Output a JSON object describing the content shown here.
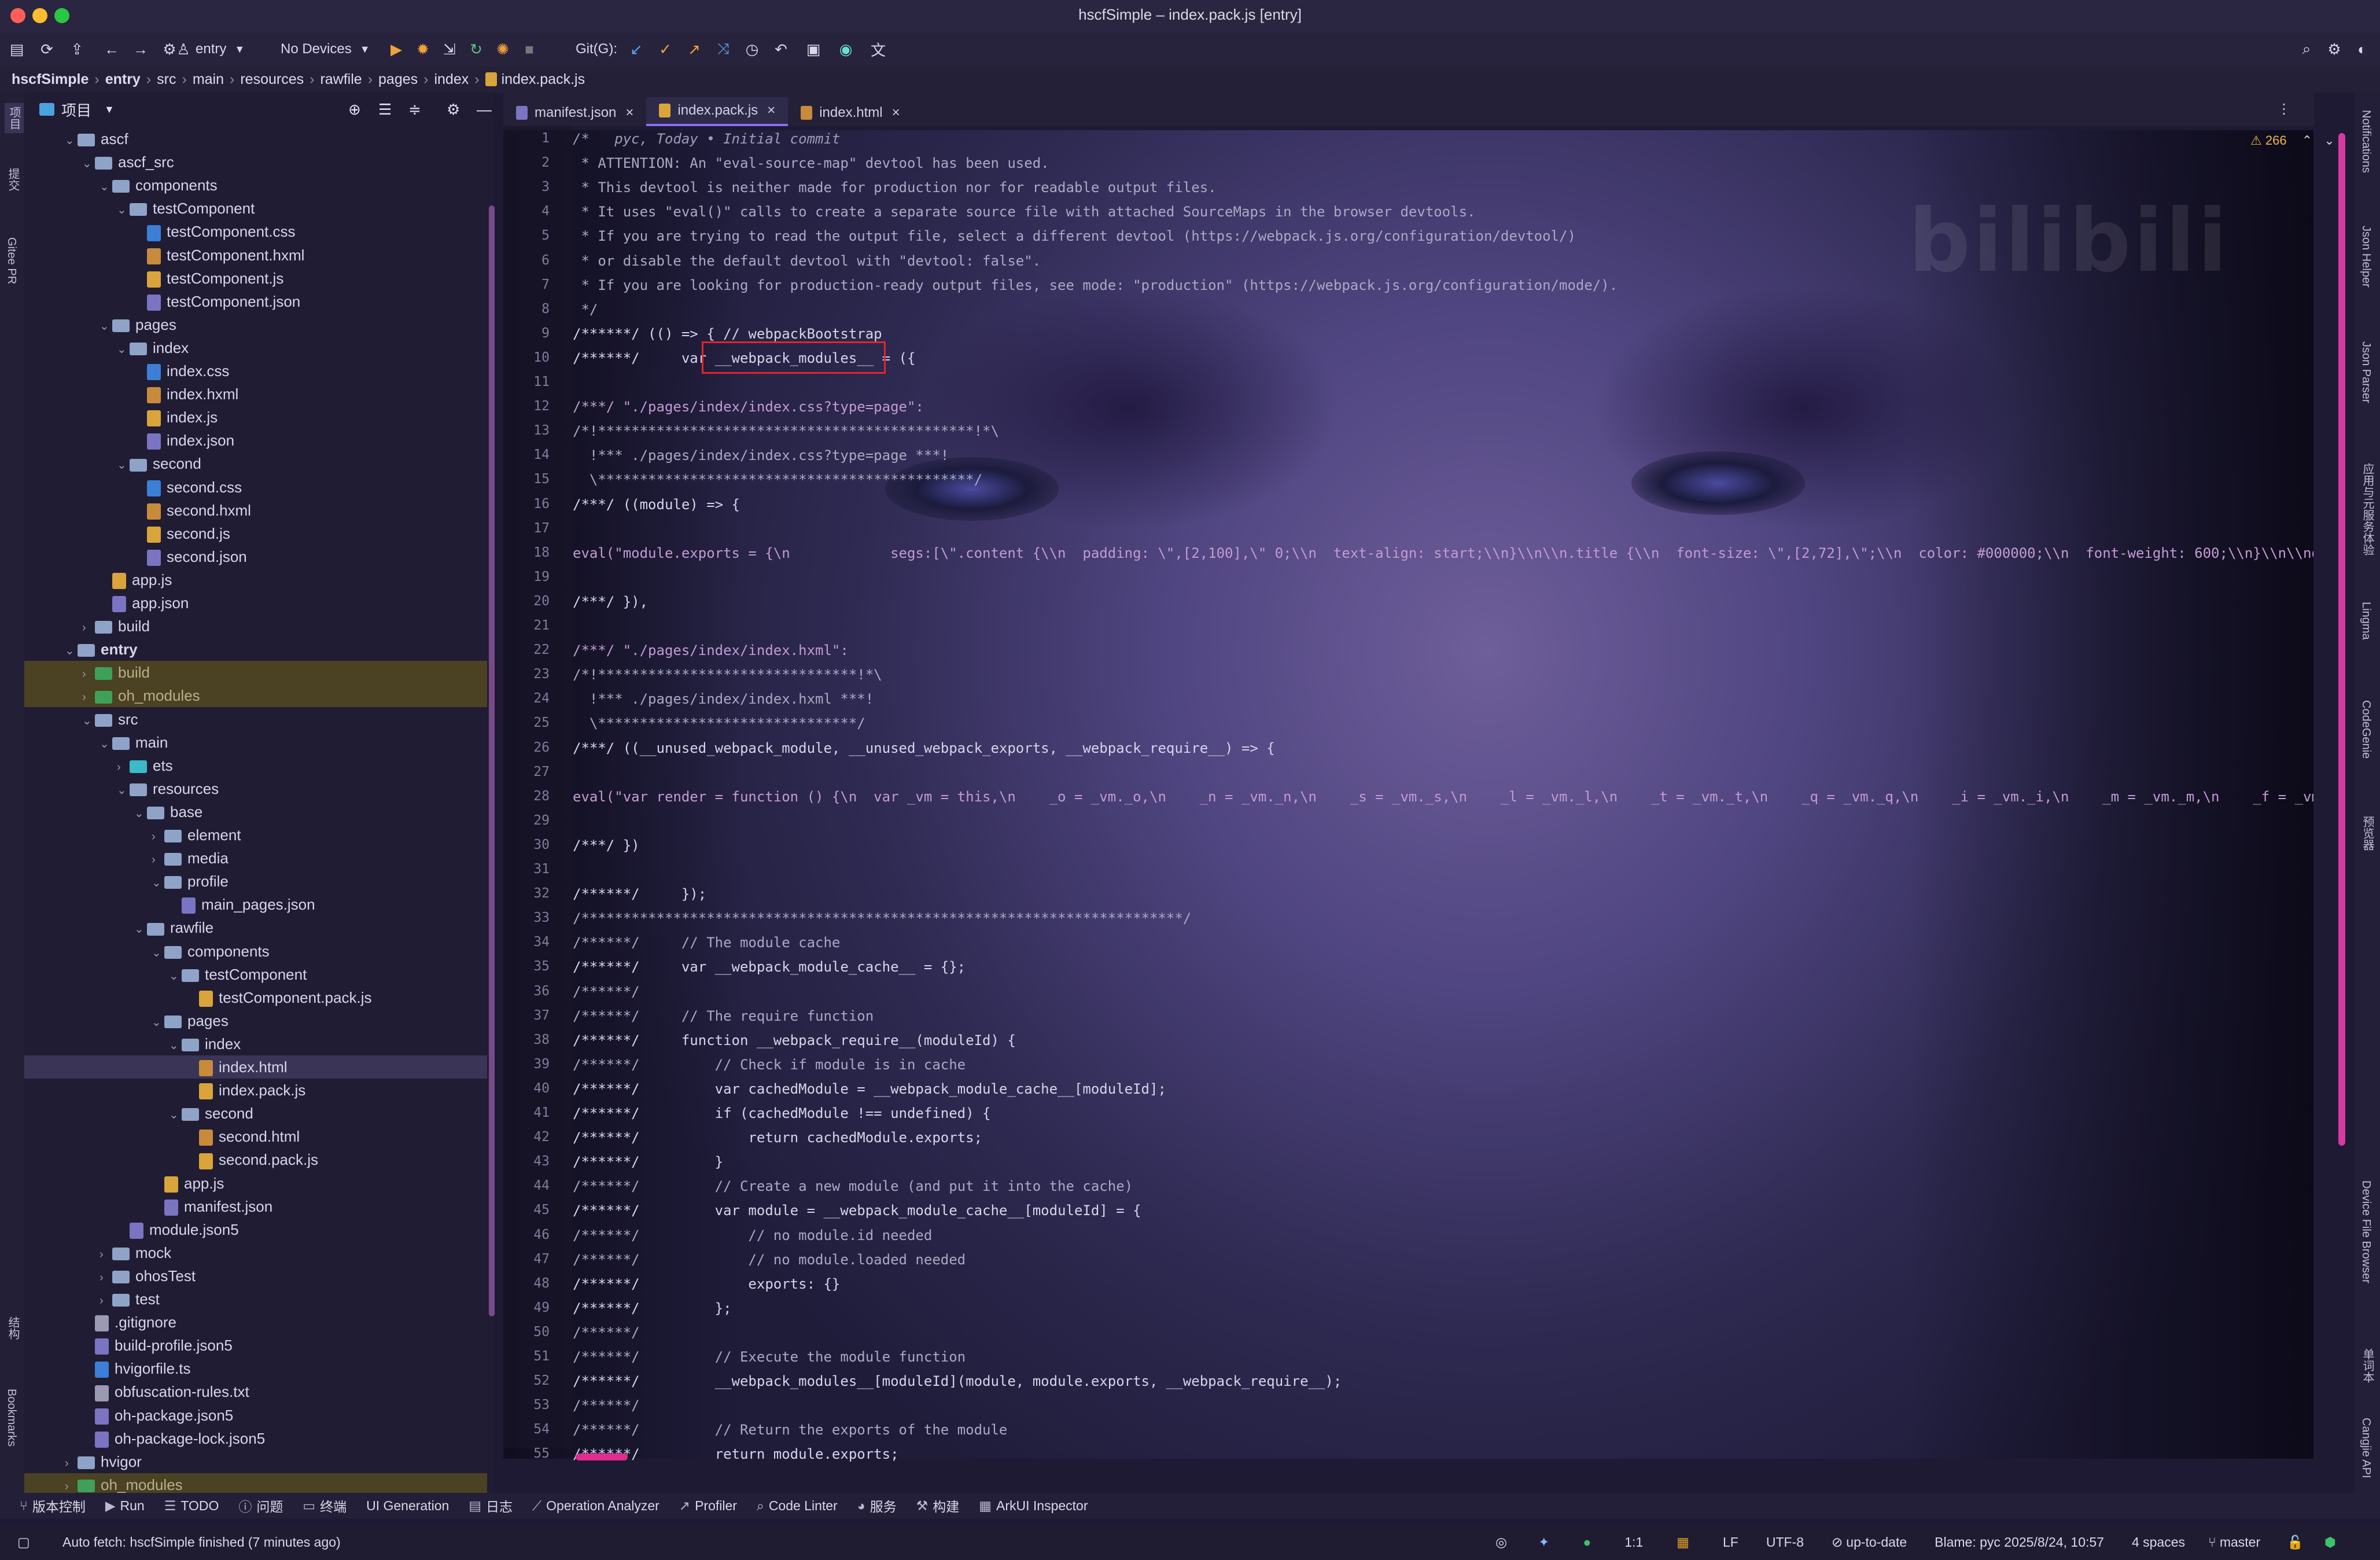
{
  "window": {
    "title": "hscfSimple – index.pack.js [entry]"
  },
  "toolbar": {
    "module": "entry",
    "devices": "No Devices",
    "git_label": "Git(G):"
  },
  "breadcrumb": [
    "hscfSimple",
    "entry",
    "src",
    "main",
    "resources",
    "rawfile",
    "pages",
    "index",
    "index.pack.js"
  ],
  "left_strip": {
    "project": "项目",
    "commit": "提交",
    "gitee": "Gitee PR",
    "structure": "结构",
    "bookmarks": "Bookmarks"
  },
  "project_panel": {
    "title": "项目",
    "tree": [
      {
        "depth": 1,
        "type": "folder",
        "name": "ascf",
        "open": true
      },
      {
        "depth": 2,
        "type": "folder",
        "name": "ascf_src",
        "open": true
      },
      {
        "depth": 3,
        "type": "folder",
        "name": "components",
        "open": true
      },
      {
        "depth": 4,
        "type": "folder",
        "name": "testComponent",
        "open": true
      },
      {
        "depth": 5,
        "type": "css",
        "name": "testComponent.css"
      },
      {
        "depth": 5,
        "type": "hxml",
        "name": "testComponent.hxml"
      },
      {
        "depth": 5,
        "type": "js",
        "name": "testComponent.js"
      },
      {
        "depth": 5,
        "type": "json",
        "name": "testComponent.json"
      },
      {
        "depth": 3,
        "type": "folder",
        "name": "pages",
        "open": true
      },
      {
        "depth": 4,
        "type": "folder",
        "name": "index",
        "open": true
      },
      {
        "depth": 5,
        "type": "css",
        "name": "index.css"
      },
      {
        "depth": 5,
        "type": "hxml",
        "name": "index.hxml"
      },
      {
        "depth": 5,
        "type": "js",
        "name": "index.js"
      },
      {
        "depth": 5,
        "type": "json",
        "name": "index.json"
      },
      {
        "depth": 4,
        "type": "folder",
        "name": "second",
        "open": true
      },
      {
        "depth": 5,
        "type": "css",
        "name": "second.css"
      },
      {
        "depth": 5,
        "type": "hxml",
        "name": "second.hxml"
      },
      {
        "depth": 5,
        "type": "js",
        "name": "second.js"
      },
      {
        "depth": 5,
        "type": "json",
        "name": "second.json"
      },
      {
        "depth": 3,
        "type": "js",
        "name": "app.js"
      },
      {
        "depth": 3,
        "type": "json",
        "name": "app.json"
      },
      {
        "depth": 2,
        "type": "folder",
        "name": "build",
        "open": false
      },
      {
        "depth": 1,
        "type": "folder",
        "name": "entry",
        "open": true,
        "bold": true
      },
      {
        "depth": 2,
        "type": "folder-green",
        "name": "build",
        "open": false,
        "hl": true
      },
      {
        "depth": 2,
        "type": "folder-green",
        "name": "oh_modules",
        "open": false,
        "hl": true
      },
      {
        "depth": 2,
        "type": "folder",
        "name": "src",
        "open": true
      },
      {
        "depth": 3,
        "type": "folder",
        "name": "main",
        "open": true
      },
      {
        "depth": 4,
        "type": "folder-cyan",
        "name": "ets",
        "open": false
      },
      {
        "depth": 4,
        "type": "folder",
        "name": "resources",
        "open": true
      },
      {
        "depth": 5,
        "type": "folder",
        "name": "base",
        "open": true
      },
      {
        "depth": 6,
        "type": "folder",
        "name": "element",
        "open": false
      },
      {
        "depth": 6,
        "type": "folder",
        "name": "media",
        "open": false
      },
      {
        "depth": 6,
        "type": "folder",
        "name": "profile",
        "open": true
      },
      {
        "depth": 7,
        "type": "json",
        "name": "main_pages.json"
      },
      {
        "depth": 5,
        "type": "folder",
        "name": "rawfile",
        "open": true
      },
      {
        "depth": 6,
        "type": "folder",
        "name": "components",
        "open": true
      },
      {
        "depth": 7,
        "type": "folder",
        "name": "testComponent",
        "open": true
      },
      {
        "depth": 8,
        "type": "js",
        "name": "testComponent.pack.js"
      },
      {
        "depth": 6,
        "type": "folder",
        "name": "pages",
        "open": true
      },
      {
        "depth": 7,
        "type": "folder",
        "name": "index",
        "open": true
      },
      {
        "depth": 8,
        "type": "hxml",
        "name": "index.html",
        "sel": true
      },
      {
        "depth": 8,
        "type": "js",
        "name": "index.pack.js"
      },
      {
        "depth": 7,
        "type": "folder",
        "name": "second",
        "open": true
      },
      {
        "depth": 8,
        "type": "hxml",
        "name": "second.html"
      },
      {
        "depth": 8,
        "type": "js",
        "name": "second.pack.js"
      },
      {
        "depth": 6,
        "type": "js",
        "name": "app.js"
      },
      {
        "depth": 6,
        "type": "json",
        "name": "manifest.json"
      },
      {
        "depth": 4,
        "type": "json",
        "name": "module.json5"
      },
      {
        "depth": 3,
        "type": "folder",
        "name": "mock",
        "open": false
      },
      {
        "depth": 3,
        "type": "folder",
        "name": "ohosTest",
        "open": false
      },
      {
        "depth": 3,
        "type": "folder",
        "name": "test",
        "open": false
      },
      {
        "depth": 2,
        "type": "txt",
        "name": ".gitignore"
      },
      {
        "depth": 2,
        "type": "json",
        "name": "build-profile.json5"
      },
      {
        "depth": 2,
        "type": "css",
        "name": "hvigorfile.ts"
      },
      {
        "depth": 2,
        "type": "txt",
        "name": "obfuscation-rules.txt"
      },
      {
        "depth": 2,
        "type": "json",
        "name": "oh-package.json5"
      },
      {
        "depth": 2,
        "type": "json",
        "name": "oh-package-lock.json5"
      },
      {
        "depth": 1,
        "type": "folder",
        "name": "hvigor",
        "open": false
      },
      {
        "depth": 1,
        "type": "folder-green",
        "name": "oh_modules",
        "open": false,
        "hl": true
      }
    ]
  },
  "tabs": [
    {
      "label": "manifest.json",
      "active": false
    },
    {
      "label": "index.pack.js",
      "active": true
    },
    {
      "label": "index.html",
      "active": false
    }
  ],
  "editor": {
    "warnings": "266",
    "lines": [
      {
        "n": "1",
        "c": "/*   pyc, Today • Initial commit",
        "cls": "cmt"
      },
      {
        "n": "2",
        "c": " * ATTENTION: An \"eval-source-map\" devtool has been used.",
        "cls": "dim"
      },
      {
        "n": "3",
        "c": " * This devtool is neither made for production nor for readable output files.",
        "cls": "dim"
      },
      {
        "n": "4",
        "c": " * It uses \"eval()\" calls to create a separate source file with attached SourceMaps in the browser devtools.",
        "cls": "dim"
      },
      {
        "n": "5",
        "c": " * If you are trying to read the output file, select a different devtool (https://webpack.js.org/configuration/devtool/)",
        "cls": "dim"
      },
      {
        "n": "6",
        "c": " * or disable the default devtool with \"devtool: false\".",
        "cls": "dim"
      },
      {
        "n": "7",
        "c": " * If you are looking for production-ready output files, see mode: \"production\" (https://webpack.js.org/configuration/mode/).",
        "cls": "dim"
      },
      {
        "n": "8",
        "c": " */",
        "cls": "dim"
      },
      {
        "n": "9",
        "c": "/******/ (() => { // webpackBootstrap",
        "cls": ""
      },
      {
        "n": "10",
        "c": "/******/     var __webpack_modules__ = ({",
        "cls": ""
      },
      {
        "n": "11",
        "c": "",
        "cls": ""
      },
      {
        "n": "12",
        "c": "/***/ \"./pages/index/index.css?type=page\":",
        "cls": "str"
      },
      {
        "n": "13",
        "c": "/*!*********************************************!*\\",
        "cls": "dim"
      },
      {
        "n": "14",
        "c": "  !*** ./pages/index/index.css?type=page ***!",
        "cls": "dim"
      },
      {
        "n": "15",
        "c": "  \\*********************************************/",
        "cls": "dim"
      },
      {
        "n": "16",
        "c": "/***/ ((module) => {",
        "cls": ""
      },
      {
        "n": "17",
        "c": "",
        "cls": ""
      },
      {
        "n": "18",
        "c": "eval(\"module.exports = {\\n            segs:[\\\".content {\\\\n  padding: \\\",[2,100],\\\" 0;\\\\n  text-align: start;\\\\n}\\\\n\\\\n.title {\\\\n  font-size: \\\",[2,72],\\\";\\\\n  color: #000000;\\\\n  font-weight: 600;\\\\n}\\\\n\\\\nq-pag",
        "cls": "str"
      },
      {
        "n": "19",
        "c": "",
        "cls": ""
      },
      {
        "n": "20",
        "c": "/***/ }),",
        "cls": ""
      },
      {
        "n": "21",
        "c": "",
        "cls": ""
      },
      {
        "n": "22",
        "c": "/***/ \"./pages/index/index.hxml\":",
        "cls": "str"
      },
      {
        "n": "23",
        "c": "/*!*******************************!*\\",
        "cls": "dim"
      },
      {
        "n": "24",
        "c": "  !*** ./pages/index/index.hxml ***!",
        "cls": "dim"
      },
      {
        "n": "25",
        "c": "  \\*******************************/",
        "cls": "dim"
      },
      {
        "n": "26",
        "c": "/***/ ((__unused_webpack_module, __unused_webpack_exports, __webpack_require__) => {",
        "cls": ""
      },
      {
        "n": "27",
        "c": "",
        "cls": ""
      },
      {
        "n": "28",
        "c": "eval(\"var render = function () {\\n  var _vm = this,\\n    _o = _vm._o,\\n    _n = _vm._n,\\n    _s = _vm._s,\\n    _l = _vm._l,\\n    _t = _vm._t,\\n    _q = _vm._q,\\n    _i = _vm._i,\\n    _m = _vm._m,\\n    _f = _vm._f",
        "cls": "str"
      },
      {
        "n": "29",
        "c": "",
        "cls": ""
      },
      {
        "n": "30",
        "c": "/***/ })",
        "cls": ""
      },
      {
        "n": "31",
        "c": "",
        "cls": ""
      },
      {
        "n": "32",
        "c": "/******/     });",
        "cls": ""
      },
      {
        "n": "33",
        "c": "/************************************************************************/",
        "cls": "dim"
      },
      {
        "n": "34",
        "c": "/******/     // The module cache",
        "cls": "dim"
      },
      {
        "n": "35",
        "c": "/******/     var __webpack_module_cache__ = {};",
        "cls": ""
      },
      {
        "n": "36",
        "c": "/******/",
        "cls": "dim"
      },
      {
        "n": "37",
        "c": "/******/     // The require function",
        "cls": "dim"
      },
      {
        "n": "38",
        "c": "/******/     function __webpack_require__(moduleId) {",
        "cls": ""
      },
      {
        "n": "39",
        "c": "/******/         // Check if module is in cache",
        "cls": "dim"
      },
      {
        "n": "40",
        "c": "/******/         var cachedModule = __webpack_module_cache__[moduleId];",
        "cls": ""
      },
      {
        "n": "41",
        "c": "/******/         if (cachedModule !== undefined) {",
        "cls": ""
      },
      {
        "n": "42",
        "c": "/******/             return cachedModule.exports;",
        "cls": ""
      },
      {
        "n": "43",
        "c": "/******/         }",
        "cls": ""
      },
      {
        "n": "44",
        "c": "/******/         // Create a new module (and put it into the cache)",
        "cls": "dim"
      },
      {
        "n": "45",
        "c": "/******/         var module = __webpack_module_cache__[moduleId] = {",
        "cls": ""
      },
      {
        "n": "46",
        "c": "/******/             // no module.id needed",
        "cls": "dim"
      },
      {
        "n": "47",
        "c": "/******/             // no module.loaded needed",
        "cls": "dim"
      },
      {
        "n": "48",
        "c": "/******/             exports: {}",
        "cls": ""
      },
      {
        "n": "49",
        "c": "/******/         };",
        "cls": ""
      },
      {
        "n": "50",
        "c": "/******/",
        "cls": "dim"
      },
      {
        "n": "51",
        "c": "/******/         // Execute the module function",
        "cls": "dim"
      },
      {
        "n": "52",
        "c": "/******/         __webpack_modules__[moduleId](module, module.exports, __webpack_require__);",
        "cls": ""
      },
      {
        "n": "53",
        "c": "/******/",
        "cls": "dim"
      },
      {
        "n": "54",
        "c": "/******/         // Return the exports of the module",
        "cls": "dim"
      },
      {
        "n": "55",
        "c": "/******/         return module.exports;",
        "cls": ""
      }
    ]
  },
  "watermark": "bilibili",
  "right_strip": [
    "Notifications",
    "Json Helper",
    "Json Parser",
    "应用与元服务体验",
    "Lingma",
    "CodeGenie",
    "预览器",
    "Device File Browser",
    "单词本",
    "Cangjie API"
  ],
  "tool_windows": [
    {
      "icon": "branch-icon",
      "label": "版本控制"
    },
    {
      "icon": "run-icon",
      "label": "Run"
    },
    {
      "icon": "list-icon",
      "label": "TODO"
    },
    {
      "icon": "info-icon",
      "label": "问题"
    },
    {
      "icon": "terminal-icon",
      "label": "终端"
    },
    {
      "icon": "",
      "label": "UI Generation"
    },
    {
      "icon": "log-icon",
      "label": "日志"
    },
    {
      "icon": "chart-icon",
      "label": "Operation Analyzer"
    },
    {
      "icon": "profiler-icon",
      "label": "Profiler"
    },
    {
      "icon": "search-icon",
      "label": "Code Linter"
    },
    {
      "icon": "service-icon",
      "label": "服务"
    },
    {
      "icon": "hammer-icon",
      "label": "构建"
    },
    {
      "icon": "inspector-icon",
      "label": "ArkUI Inspector"
    }
  ],
  "status": {
    "message": "Auto fetch: hscfSimple finished (7 minutes ago)",
    "position": "1:1",
    "line_sep": "LF",
    "encoding": "UTF-8",
    "vcs": "up-to-date",
    "blame": "Blame: pyc 2025/8/24, 10:57",
    "indent": "4 spaces",
    "branch": "master"
  }
}
